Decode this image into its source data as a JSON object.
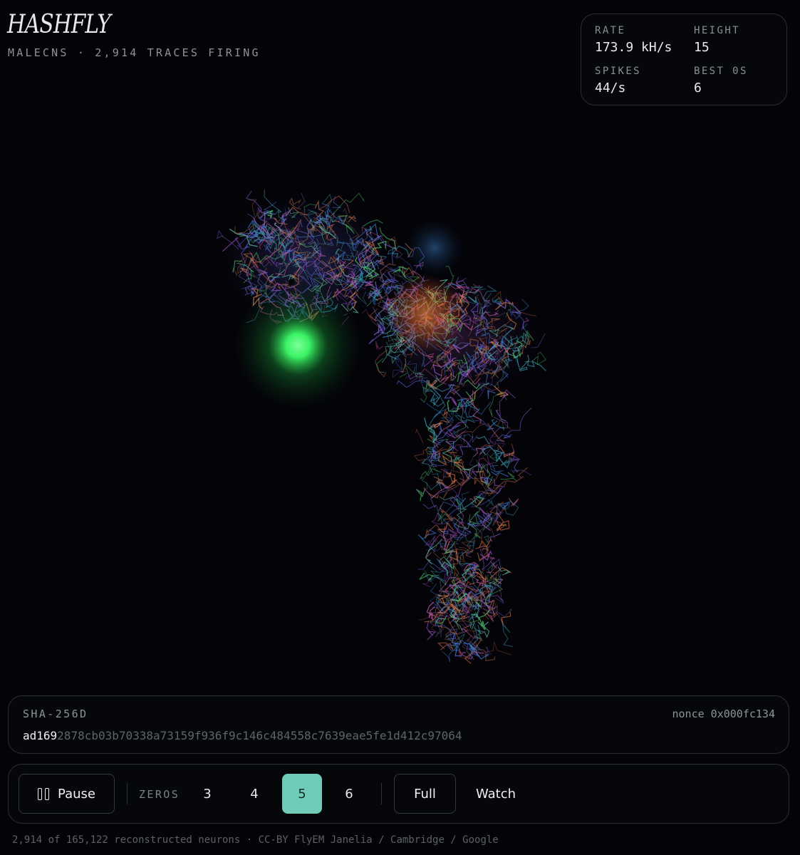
{
  "app": {
    "title": "HASHFLY",
    "subtitle": "MALECNS · 2,914 TRACES FIRING"
  },
  "stats": [
    {
      "label": "RATE",
      "value": "173.9 kH/s"
    },
    {
      "label": "HEIGHT",
      "value": "15"
    },
    {
      "label": "SPIKES",
      "value": "44/s"
    },
    {
      "label": "BEST 0S",
      "value": "6"
    }
  ],
  "hash": {
    "algorithm": "SHA-256D",
    "nonce": "nonce 0x000fc134",
    "prefix": "ad169",
    "rest": "2878cb03b70338a73159f936f9c146c484558c7639eae5fe1d412c97064"
  },
  "controls": {
    "pause_label": "Pause",
    "zeros_label": "ZEROS",
    "zero_options": [
      "3",
      "4",
      "5",
      "6"
    ],
    "selected_zero": "5",
    "full_label": "Full",
    "watch_label": "Watch"
  },
  "footer": "2,914 of 165,122 reconstructed neurons · CC-BY FlyEM Janelia / Cambridge / Google",
  "colors": {
    "accent": "#70cbb9",
    "background": "#030308",
    "panel_border": "#2b2e34",
    "glow_green": "#3dff6a"
  }
}
